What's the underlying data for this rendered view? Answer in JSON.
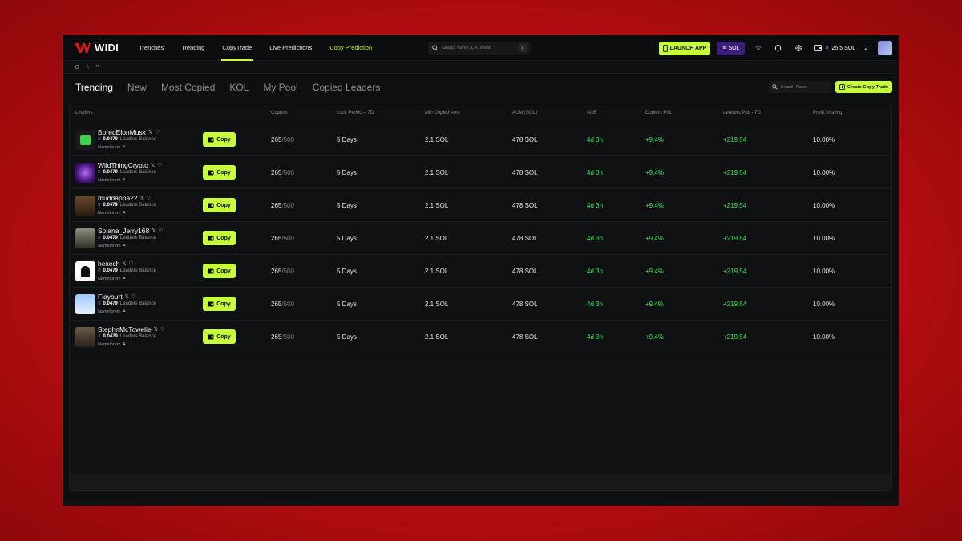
{
  "brand": {
    "name": "WIDI",
    "accent": "#c6ff3a",
    "green": "#2ee655"
  },
  "nav": {
    "items": [
      {
        "label": "Trenches"
      },
      {
        "label": "Trending"
      },
      {
        "label": "CopyTrade"
      },
      {
        "label": "Live Predictions"
      },
      {
        "label": "Copy Prediction"
      }
    ],
    "search_placeholder": "Search Name, CA, Wallet",
    "search_shortcut": "/",
    "launch_label": "LAUNCH APP",
    "chain_label": "SOL",
    "wallet_balance": "25.5 SOL"
  },
  "tabs": [
    {
      "label": "Trending"
    },
    {
      "label": "New"
    },
    {
      "label": "Most Copied"
    },
    {
      "label": "KOL"
    },
    {
      "label": "My Pool"
    },
    {
      "label": "Copied Leaders"
    }
  ],
  "name_search_placeholder": "Search Name",
  "create_label": "Create Copy Trade",
  "columns": {
    "leaders": "Leaders",
    "copiers": "Copiers",
    "lock": "Lock Period – 7D",
    "min": "Min Copied Amt.",
    "aum": "AUM (SOL)",
    "age": "AGE",
    "cpnl": "Copiers PnL",
    "lpnl": "Leaders PnL - 7D",
    "profit": "Profit Sharing"
  },
  "rows": [
    {
      "name": "BoredElonMusk",
      "balance": "0.0479",
      "balance_label": "Leaders Balance",
      "sub": "Namelorem",
      "copy": "Copy",
      "copiers": "265",
      "copiers_max": "/500",
      "lock": "5 Days",
      "min": "2.1 SOL",
      "aum": "478 SOL",
      "age": "4d 3h",
      "cpnl": "+9.4%",
      "lpnl": "+219.54",
      "profit": "10.00%"
    },
    {
      "name": "WildThingCrypto",
      "balance": "0.0479",
      "balance_label": "Leaders Balance",
      "sub": "Namelorem",
      "copy": "Copy",
      "copiers": "265",
      "copiers_max": "/500",
      "lock": "5 Days",
      "min": "2.1 SOL",
      "aum": "478 SOL",
      "age": "4d 3h",
      "cpnl": "+9.4%",
      "lpnl": "+219.54",
      "profit": "10.00%"
    },
    {
      "name": "muddappa22",
      "balance": "0.0479",
      "balance_label": "Leaders Balance",
      "sub": "Namelorem",
      "copy": "Copy",
      "copiers": "265",
      "copiers_max": "/500",
      "lock": "5 Days",
      "min": "2.1 SOL",
      "aum": "478 SOL",
      "age": "4d 3h",
      "cpnl": "+9.4%",
      "lpnl": "+219.54",
      "profit": "10.00%"
    },
    {
      "name": "Solana_Jerry168",
      "balance": "0.0479",
      "balance_label": "Leaders Balance",
      "sub": "Namelorem",
      "copy": "Copy",
      "copiers": "265",
      "copiers_max": "/500",
      "lock": "5 Days",
      "min": "2.1 SOL",
      "aum": "478 SOL",
      "age": "4d 3h",
      "cpnl": "+9.4%",
      "lpnl": "+219.54",
      "profit": "10.00%"
    },
    {
      "name": "hexech",
      "balance": "0.0479",
      "balance_label": "Leaders Balance",
      "sub": "Namelorem",
      "copy": "Copy",
      "copiers": "265",
      "copiers_max": "/500",
      "lock": "5 Days",
      "min": "2.1 SOL",
      "aum": "478 SOL",
      "age": "4d 3h",
      "cpnl": "+9.4%",
      "lpnl": "+219.54",
      "profit": "10.00%"
    },
    {
      "name": "Flayourt",
      "balance": "0.0479",
      "balance_label": "Leaders Balance",
      "sub": "Namelorem",
      "copy": "Copy",
      "copiers": "265",
      "copiers_max": "/500",
      "lock": "5 Days",
      "min": "2.1 SOL",
      "aum": "478 SOL",
      "age": "4d 3h",
      "cpnl": "+9.4%",
      "lpnl": "+219.54",
      "profit": "10.00%"
    },
    {
      "name": "StephnMcTowelie",
      "balance": "0.0479",
      "balance_label": "Leaders Balance",
      "sub": "Namelorem",
      "copy": "Copy",
      "copiers": "265",
      "copiers_max": "/500",
      "lock": "5 Days",
      "min": "2.1 SOL",
      "aum": "478 SOL",
      "age": "4d 3h",
      "cpnl": "+9.4%",
      "lpnl": "+219.54",
      "profit": "10.00%"
    }
  ]
}
